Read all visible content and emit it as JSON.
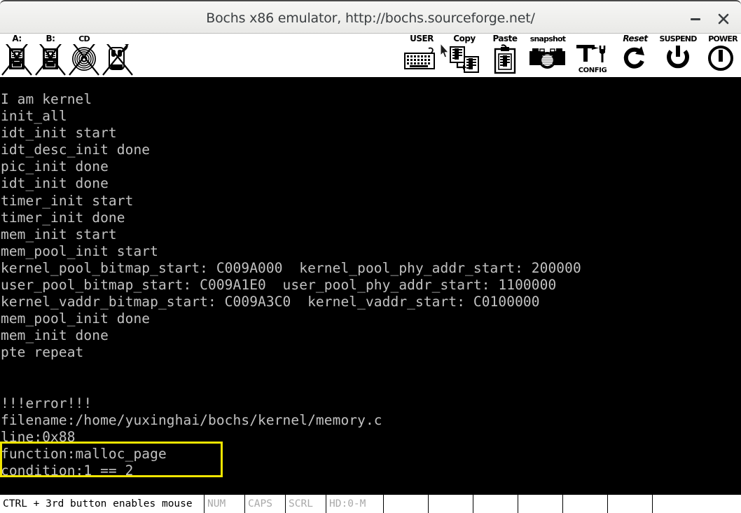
{
  "window": {
    "title": "Bochs x86 emulator, http://bochs.sourceforge.net/",
    "minimize_label": "–",
    "close_label": "×"
  },
  "toolbar": {
    "left_buttons": [
      {
        "name": "floppy-a-button",
        "label": "A:",
        "icon": "floppy-disabled-icon"
      },
      {
        "name": "floppy-b-button",
        "label": "B:",
        "icon": "floppy-disabled-icon"
      },
      {
        "name": "cdrom-button",
        "label": "CD",
        "icon": "cdrom-disabled-icon"
      },
      {
        "name": "mouse-button",
        "label": "",
        "icon": "mouse-disabled-icon"
      }
    ],
    "right_buttons": [
      {
        "name": "user-button",
        "label": "USER",
        "icon": "keyboard-icon",
        "sub": ""
      },
      {
        "name": "copy-button",
        "label": "Copy",
        "icon": "copy-icon",
        "sub": ""
      },
      {
        "name": "paste-button",
        "label": "Paste",
        "icon": "clipboard-icon",
        "sub": ""
      },
      {
        "name": "snapshot-button",
        "label": "snapshot",
        "icon": "camera-icon",
        "sub": ""
      },
      {
        "name": "config-button",
        "label": "",
        "icon": "wrench-icon",
        "sub": "CONFIG"
      },
      {
        "name": "reset-button",
        "label": "Reset",
        "icon": "reset-icon",
        "sub": ""
      },
      {
        "name": "suspend-button",
        "label": "SUSPEND",
        "icon": "power-off-icon",
        "sub": ""
      },
      {
        "name": "power-button",
        "label": "POWER",
        "icon": "power-icon",
        "sub": ""
      }
    ]
  },
  "console": {
    "foreground_color": "#c2c2c2",
    "background_color": "#000000",
    "highlight_color": "#f2e500",
    "lines": [
      "I am kernel",
      "init_all",
      "idt_init start",
      "idt_desc_init done",
      "pic_init done",
      "idt_init done",
      "timer_init start",
      "timer_init done",
      "mem_init start",
      "mem_pool_init start",
      "kernel_pool_bitmap_start: C009A000  kernel_pool_phy_addr_start: 200000",
      "user_pool_bitmap_start: C009A1E0  user_pool_phy_addr_start: 1100000",
      "kernel_vaddr_bitmap_start: C009A3C0  kernel_vaddr_start: C0100000",
      "mem_pool_init done",
      "mem_init done",
      "pte repeat",
      "",
      "",
      "!!!error!!!",
      "filename:/home/yuxinghai/bochs/kernel/memory.c",
      "line:0x88",
      "function:malloc_page",
      "condition:1 == 2"
    ],
    "text": "I am kernel\ninit_all\nidt_init start\nidt_desc_init done\npic_init done\nidt_init done\ntimer_init start\ntimer_init done\nmem_init start\nmem_pool_init start\nkernel_pool_bitmap_start: C009A000  kernel_pool_phy_addr_start: 200000\nuser_pool_bitmap_start: C009A1E0  user_pool_phy_addr_start: 1100000\nkernel_vaddr_bitmap_start: C009A3C0  kernel_vaddr_start: C0100000\nmem_pool_init done\nmem_init done\npte repeat\n\n\n!!!error!!!\nfilename:/home/yuxinghai/bochs/kernel/memory.c\nline:0x88\nfunction:malloc_page\ncondition:1 == 2"
  },
  "statusbar": {
    "message": "CTRL + 3rd button enables mouse",
    "indicators": [
      {
        "name": "num-lock-indicator",
        "label": "NUM"
      },
      {
        "name": "caps-lock-indicator",
        "label": "CAPS"
      },
      {
        "name": "scroll-lock-indicator",
        "label": "SCRL"
      },
      {
        "name": "hd-activity-indicator",
        "label": "HD:0-M"
      }
    ]
  }
}
